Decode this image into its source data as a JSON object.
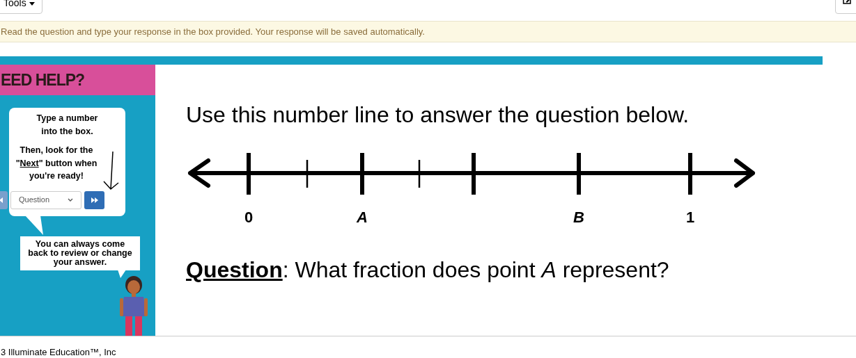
{
  "toolbar": {
    "tools_label": "Tools"
  },
  "instructions": "Read the question and type your response in the box provided. Your response will be saved automatically.",
  "help": {
    "title": "EED HELP?",
    "bubble1": {
      "line1": "Type a number into the box.",
      "line2_before": "Then, look for the \"",
      "next_word": "Next",
      "line2_after": "\" button when you're ready!"
    },
    "nav": {
      "select_value": "Question"
    },
    "bubble2": "You can always come back to review or change your answer."
  },
  "prompt": "Use this number line to answer the question below.",
  "number_line": {
    "labels": [
      "0",
      "A",
      "B",
      "1"
    ]
  },
  "question": {
    "label": "Question",
    "text": ": What fraction does point *A* represent?"
  },
  "footer": {
    "text": "3  Illuminate Education™, Inc"
  }
}
